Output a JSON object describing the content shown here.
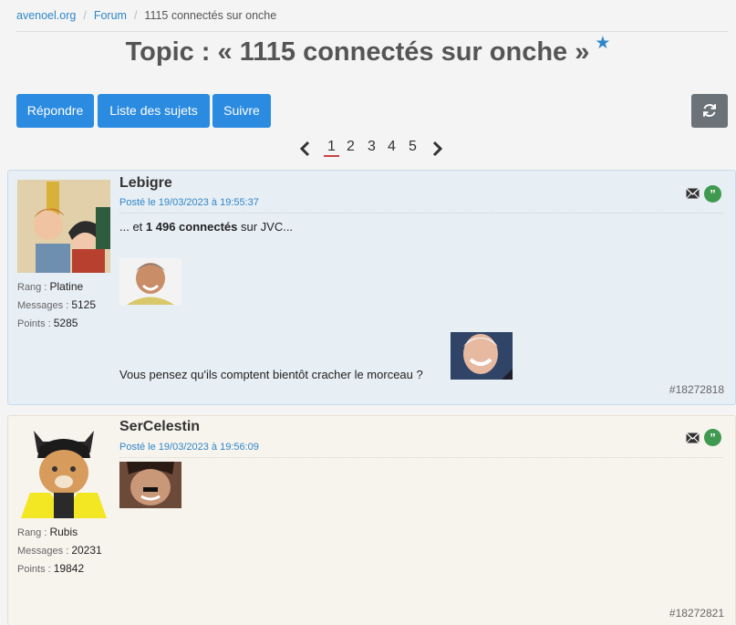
{
  "breadcrumb": {
    "home": "avenoel.org",
    "forum": "Forum",
    "current": "1115 connectés sur onche"
  },
  "topic": {
    "title": "Topic : « 1115 connectés sur onche »",
    "star_icon": "star-icon"
  },
  "toolbar": {
    "reply": "Répondre",
    "list": "Liste des sujets",
    "follow": "Suivre",
    "refresh_icon": "refresh-icon"
  },
  "pagination": {
    "prev_icon": "chevron-left-icon",
    "pages": [
      "1",
      "2",
      "3",
      "4",
      "5"
    ],
    "current": "1",
    "next_icon": "chevron-right-icon"
  },
  "colors": {
    "primary": "#2b8be0",
    "refresh": "#6b7278",
    "quote": "#3f9a50",
    "post1_bg": "#e7eef4",
    "post2_bg": "#f7f4ee"
  },
  "posts": [
    {
      "author": "Lebigre",
      "date": "Posté le 19/03/2023 à 19:55:37",
      "rank_label": "Rang",
      "rank": "Platine",
      "messages_label": "Messages",
      "messages": "5125",
      "points_label": "Points",
      "points": "5285",
      "text_prefix": "... et ",
      "text_bold": "1 496 connectés",
      "text_suffix": " sur JVC...",
      "text_2": "Vous pensez qu'ils comptent bientôt cracher le morceau ?",
      "id": "#18272818"
    },
    {
      "author": "SerCelestin",
      "date": "Posté le 19/03/2023 à 19:56:09",
      "rank_label": "Rang",
      "rank": "Rubis",
      "messages_label": "Messages",
      "messages": "20231",
      "points_label": "Points",
      "points": "19842",
      "id": "#18272821"
    }
  ]
}
